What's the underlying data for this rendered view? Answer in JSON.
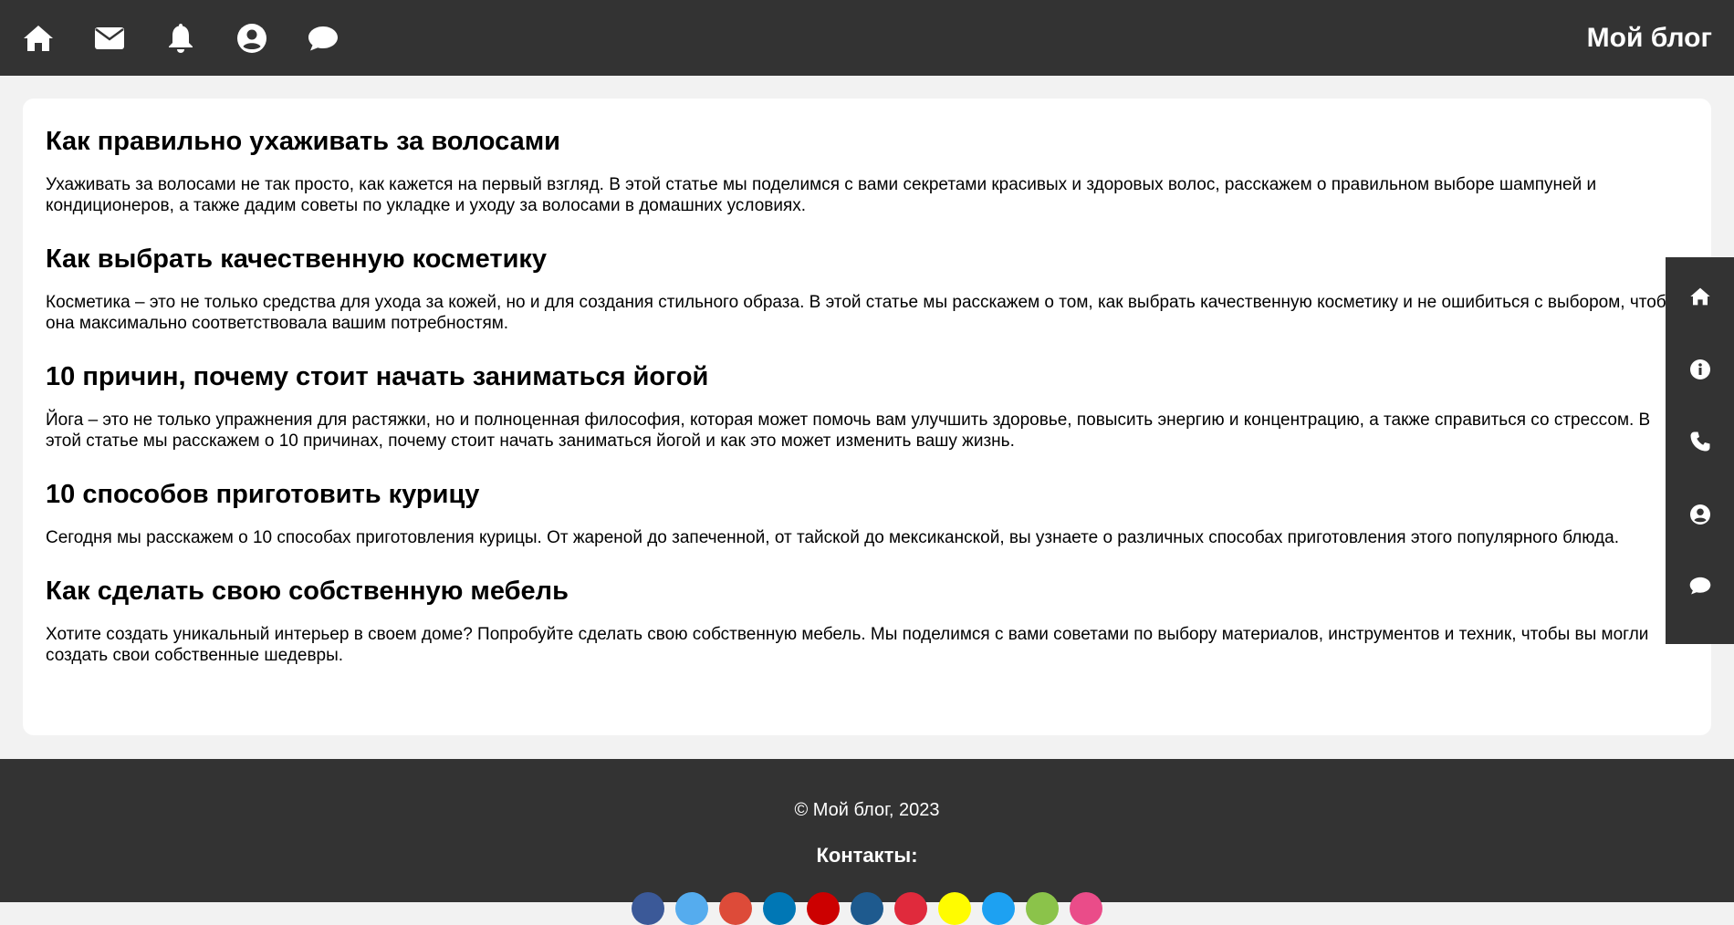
{
  "header": {
    "title": "Мой блог",
    "icons": [
      "home-icon",
      "envelope-icon",
      "bell-icon",
      "user-circle-icon",
      "comment-icon"
    ]
  },
  "posts": [
    {
      "title": "Как правильно ухаживать за волосами",
      "text": "Ухаживать за волосами не так просто, как кажется на первый взгляд. В этой статье мы поделимся с вами секретами красивых и здоровых волос, расскажем о правильном выборе шампуней и кондиционеров, а также дадим советы по укладке и уходу за волосами в домашних условиях."
    },
    {
      "title": "Как выбрать качественную косметику",
      "text": "Косметика – это не только средства для ухода за кожей, но и для создания стильного образа. В этой статье мы расскажем о том, как выбрать качественную косметику и не ошибиться с выбором, чтобы она максимально соответствовала вашим потребностям."
    },
    {
      "title": "10 причин, почему стоит начать заниматься йогой",
      "text": "Йога – это не только упражнения для растяжки, но и полноценная философия, которая может помочь вам улучшить здоровье, повысить энергию и концентрацию, а также справиться со стрессом. В этой статье мы расскажем о 10 причинах, почему стоит начать заниматься йогой и как это может изменить вашу жизнь."
    },
    {
      "title": "10 способов приготовить курицу",
      "text": "Сегодня мы расскажем о 10 способах приготовления курицы. От жареной до запеченной, от тайской до мексиканской, вы узнаете о различных способах приготовления этого популярного блюда."
    },
    {
      "title": "Как сделать свою собственную мебель",
      "text": "Хотите создать уникальный интерьер в своем доме? Попробуйте сделать свою собственную мебель. Мы поделимся с вами советами по выбору материалов, инструментов и техник, чтобы вы могли создать свои собственные шедевры."
    }
  ],
  "sidebar": {
    "icons": [
      "home-icon",
      "info-icon",
      "phone-icon",
      "user-circle-icon",
      "comment-icon"
    ]
  },
  "footer": {
    "copyright": "© Мой блог, 2023",
    "contacts_title": "Контакты:",
    "social_colors": [
      "#3b5998",
      "#55acee",
      "#dd4b39",
      "#0077b5",
      "#cc0000",
      "#1e5a8e",
      "#e02a3c",
      "#fffc00",
      "#1da1f2",
      "#8bc34a",
      "#ea4c89"
    ]
  },
  "colors": {
    "header_bg": "#333333",
    "page_bg": "#f2f2f2",
    "card_bg": "#ffffff"
  }
}
